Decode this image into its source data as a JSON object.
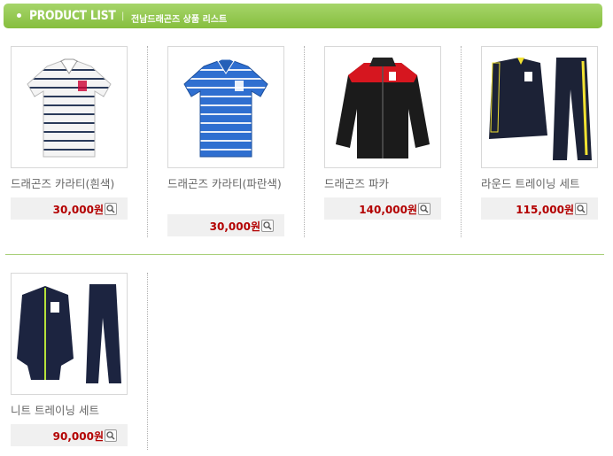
{
  "header": {
    "title": "PRODUCT LIST",
    "separator": "|",
    "subtitle": "전남드래곤즈 상품 리스트"
  },
  "products": [
    {
      "name": "드래곤즈 카라티(흰색)",
      "price": "30,000원",
      "image": "white-striped-polo-shirt"
    },
    {
      "name": "드래곤즈 카라티(파란색)",
      "price": "30,000원",
      "image": "blue-striped-polo-shirt"
    },
    {
      "name": "드래곤즈 파카",
      "price": "140,000원",
      "image": "black-red-parka"
    },
    {
      "name": "라운드 트레이닝 세트",
      "price": "115,000원",
      "image": "navy-yellow-round-training-set"
    },
    {
      "name": "니트 트레이닝 세트",
      "price": "90,000원",
      "image": "navy-knit-training-set"
    }
  ],
  "icons": {
    "zoom": "magnifier-icon",
    "bullet": "dot-icon"
  },
  "colors": {
    "header": "#86be3e",
    "price": "#b30000",
    "divider": "#a8cf78"
  }
}
